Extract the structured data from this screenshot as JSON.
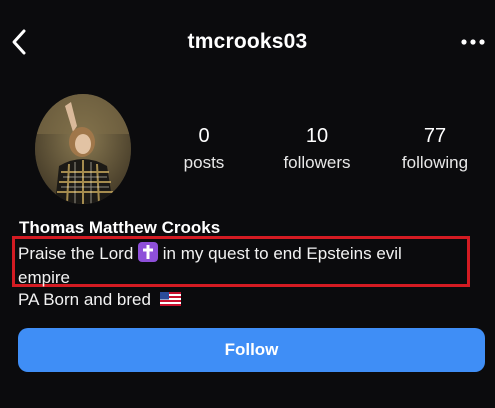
{
  "header": {
    "username": "tmcrooks03",
    "back_icon": "chevron-left-icon",
    "more_icon": "more-horizontal-icon"
  },
  "stats": {
    "posts": {
      "value": "0",
      "label": "posts"
    },
    "followers": {
      "value": "10",
      "label": "followers"
    },
    "following": {
      "value": "77",
      "label": "following"
    }
  },
  "profile": {
    "display_name": "Thomas Matthew Crooks",
    "bio_line1_a": "Praise the Lord",
    "bio_line1_b": "in my quest to end Epsteins evil",
    "bio_line2": "empire",
    "bio_line3": "PA Born and bred",
    "bio_emoji": "latin-cross-emoji",
    "flag_emoji": "us-flag-emoji"
  },
  "actions": {
    "follow_label": "Follow"
  },
  "colors": {
    "background": "#0b0b0d",
    "follow_button": "#3f8ef6",
    "highlight_box": "#d31b22",
    "cross_emoji_bg": "#8e4fd9"
  }
}
